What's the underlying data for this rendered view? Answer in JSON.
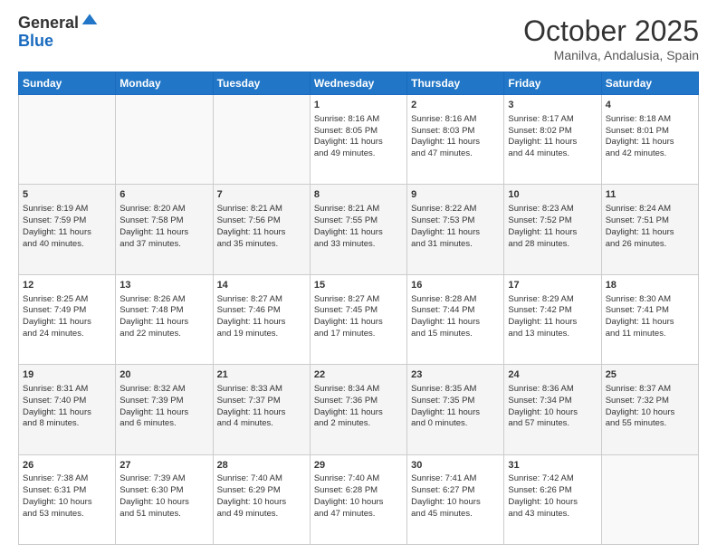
{
  "logo": {
    "general": "General",
    "blue": "Blue"
  },
  "header": {
    "month": "October 2025",
    "location": "Manilva, Andalusia, Spain"
  },
  "days_of_week": [
    "Sunday",
    "Monday",
    "Tuesday",
    "Wednesday",
    "Thursday",
    "Friday",
    "Saturday"
  ],
  "weeks": [
    [
      {
        "day": "",
        "info": ""
      },
      {
        "day": "",
        "info": ""
      },
      {
        "day": "",
        "info": ""
      },
      {
        "day": "1",
        "info": "Sunrise: 8:16 AM\nSunset: 8:05 PM\nDaylight: 11 hours\nand 49 minutes."
      },
      {
        "day": "2",
        "info": "Sunrise: 8:16 AM\nSunset: 8:03 PM\nDaylight: 11 hours\nand 47 minutes."
      },
      {
        "day": "3",
        "info": "Sunrise: 8:17 AM\nSunset: 8:02 PM\nDaylight: 11 hours\nand 44 minutes."
      },
      {
        "day": "4",
        "info": "Sunrise: 8:18 AM\nSunset: 8:01 PM\nDaylight: 11 hours\nand 42 minutes."
      }
    ],
    [
      {
        "day": "5",
        "info": "Sunrise: 8:19 AM\nSunset: 7:59 PM\nDaylight: 11 hours\nand 40 minutes."
      },
      {
        "day": "6",
        "info": "Sunrise: 8:20 AM\nSunset: 7:58 PM\nDaylight: 11 hours\nand 37 minutes."
      },
      {
        "day": "7",
        "info": "Sunrise: 8:21 AM\nSunset: 7:56 PM\nDaylight: 11 hours\nand 35 minutes."
      },
      {
        "day": "8",
        "info": "Sunrise: 8:21 AM\nSunset: 7:55 PM\nDaylight: 11 hours\nand 33 minutes."
      },
      {
        "day": "9",
        "info": "Sunrise: 8:22 AM\nSunset: 7:53 PM\nDaylight: 11 hours\nand 31 minutes."
      },
      {
        "day": "10",
        "info": "Sunrise: 8:23 AM\nSunset: 7:52 PM\nDaylight: 11 hours\nand 28 minutes."
      },
      {
        "day": "11",
        "info": "Sunrise: 8:24 AM\nSunset: 7:51 PM\nDaylight: 11 hours\nand 26 minutes."
      }
    ],
    [
      {
        "day": "12",
        "info": "Sunrise: 8:25 AM\nSunset: 7:49 PM\nDaylight: 11 hours\nand 24 minutes."
      },
      {
        "day": "13",
        "info": "Sunrise: 8:26 AM\nSunset: 7:48 PM\nDaylight: 11 hours\nand 22 minutes."
      },
      {
        "day": "14",
        "info": "Sunrise: 8:27 AM\nSunset: 7:46 PM\nDaylight: 11 hours\nand 19 minutes."
      },
      {
        "day": "15",
        "info": "Sunrise: 8:27 AM\nSunset: 7:45 PM\nDaylight: 11 hours\nand 17 minutes."
      },
      {
        "day": "16",
        "info": "Sunrise: 8:28 AM\nSunset: 7:44 PM\nDaylight: 11 hours\nand 15 minutes."
      },
      {
        "day": "17",
        "info": "Sunrise: 8:29 AM\nSunset: 7:42 PM\nDaylight: 11 hours\nand 13 minutes."
      },
      {
        "day": "18",
        "info": "Sunrise: 8:30 AM\nSunset: 7:41 PM\nDaylight: 11 hours\nand 11 minutes."
      }
    ],
    [
      {
        "day": "19",
        "info": "Sunrise: 8:31 AM\nSunset: 7:40 PM\nDaylight: 11 hours\nand 8 minutes."
      },
      {
        "day": "20",
        "info": "Sunrise: 8:32 AM\nSunset: 7:39 PM\nDaylight: 11 hours\nand 6 minutes."
      },
      {
        "day": "21",
        "info": "Sunrise: 8:33 AM\nSunset: 7:37 PM\nDaylight: 11 hours\nand 4 minutes."
      },
      {
        "day": "22",
        "info": "Sunrise: 8:34 AM\nSunset: 7:36 PM\nDaylight: 11 hours\nand 2 minutes."
      },
      {
        "day": "23",
        "info": "Sunrise: 8:35 AM\nSunset: 7:35 PM\nDaylight: 11 hours\nand 0 minutes."
      },
      {
        "day": "24",
        "info": "Sunrise: 8:36 AM\nSunset: 7:34 PM\nDaylight: 10 hours\nand 57 minutes."
      },
      {
        "day": "25",
        "info": "Sunrise: 8:37 AM\nSunset: 7:32 PM\nDaylight: 10 hours\nand 55 minutes."
      }
    ],
    [
      {
        "day": "26",
        "info": "Sunrise: 7:38 AM\nSunset: 6:31 PM\nDaylight: 10 hours\nand 53 minutes."
      },
      {
        "day": "27",
        "info": "Sunrise: 7:39 AM\nSunset: 6:30 PM\nDaylight: 10 hours\nand 51 minutes."
      },
      {
        "day": "28",
        "info": "Sunrise: 7:40 AM\nSunset: 6:29 PM\nDaylight: 10 hours\nand 49 minutes."
      },
      {
        "day": "29",
        "info": "Sunrise: 7:40 AM\nSunset: 6:28 PM\nDaylight: 10 hours\nand 47 minutes."
      },
      {
        "day": "30",
        "info": "Sunrise: 7:41 AM\nSunset: 6:27 PM\nDaylight: 10 hours\nand 45 minutes."
      },
      {
        "day": "31",
        "info": "Sunrise: 7:42 AM\nSunset: 6:26 PM\nDaylight: 10 hours\nand 43 minutes."
      },
      {
        "day": "",
        "info": ""
      }
    ]
  ]
}
